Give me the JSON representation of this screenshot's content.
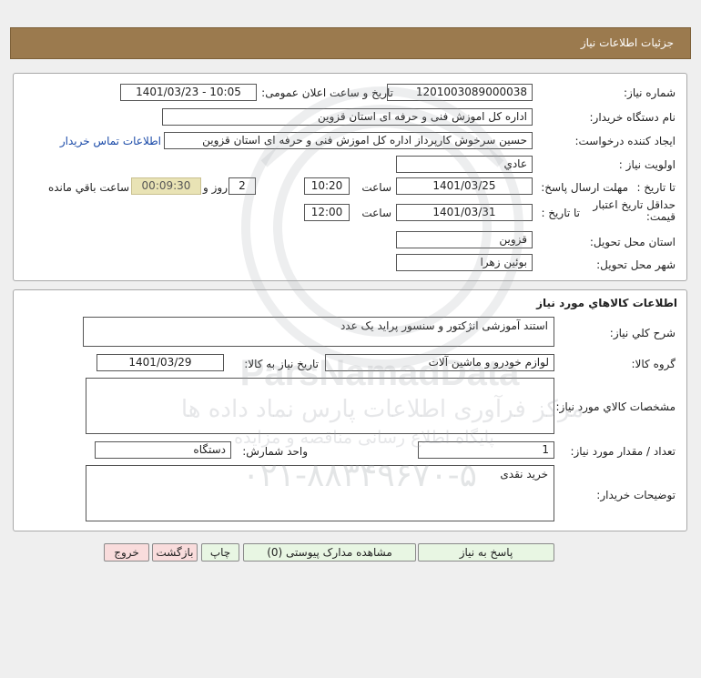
{
  "header": {
    "title": "جزئیات اطلاعات نیاز"
  },
  "need_info": {
    "need_number_label": "شماره نیاز:",
    "need_number": "1201003089000038",
    "announce_label": "تاریخ و ساعت اعلان عمومی:",
    "announce_value": "1401/03/23 - 10:05",
    "buyer_org_label": "نام دستگاه خریدار:",
    "buyer_org": "اداره کل اموزش فنی و حرفه ای استان قزوین",
    "requester_label": "ایجاد کننده درخواست:",
    "requester": "حسین سرخوش کارپرداز اداره کل اموزش فنی و حرفه ای استان قزوین",
    "contact_link": "اطلاعات تماس خریدار",
    "priority_label": "اولویت نیاز :",
    "priority": "عادي",
    "deadline_label": "مهلت ارسال پاسخ:",
    "to_date_label": "تا تاریخ :",
    "deadline_date": "1401/03/25",
    "time_label": "ساعت",
    "deadline_time": "10:20",
    "days_value": "2",
    "days_label": "روز و",
    "countdown": "00:09:30",
    "remaining_label": "ساعت باقي مانده",
    "validity_label": "حداقل تاریخ اعتبار قیمت:",
    "validity_date": "1401/03/31",
    "validity_time": "12:00",
    "province_label": "استان محل تحویل:",
    "province": "قزوین",
    "city_label": "شهر محل تحویل:",
    "city": "بوئین زهرا"
  },
  "goods": {
    "section_title": "اطلاعات کالاهاي مورد نياز",
    "summary_label": "شرح کلي نياز:",
    "summary": "استند آموزشی انژکتور و سنسور پراید یک عدد",
    "group_label": "گروه کالا:",
    "group": "لوازم خودرو و ماشین آلات",
    "need_date_label": "تاریخ نیاز به کالا:",
    "need_date": "1401/03/29",
    "specs_label": "مشخصات کالاي مورد نياز:",
    "specs": "",
    "qty_label": "تعداد / مقدار مورد نیاز:",
    "qty": "1",
    "unit_label": "واحد شمارش:",
    "unit": "دستگاه",
    "buyer_notes_label": "توضیحات خریدار:",
    "buyer_notes": "خرید نقدی"
  },
  "buttons": {
    "reply": "پاسخ به نیاز",
    "attachments": "مشاهده مدارک پیوستی (0)",
    "print": "چاپ",
    "back": "بازگشت",
    "exit": "خروج"
  },
  "watermark": {
    "brand": "ParsNamadData",
    "line1": "مرکز فرآوری اطلاعات پارس نماد داده ها",
    "line2": "پایگاه اطلاع رسانی مناقصه و مزایده",
    "phone": "۰۲۱-۸۸۳۴۹۶۷۰-۵"
  },
  "colors": {
    "header_bg": "#9b7a4e",
    "countdown_bg": "#e9e3b5",
    "link": "#1a4aa8",
    "green_btn": "#e8f6e3",
    "pink_btn": "#f9dcdc"
  }
}
